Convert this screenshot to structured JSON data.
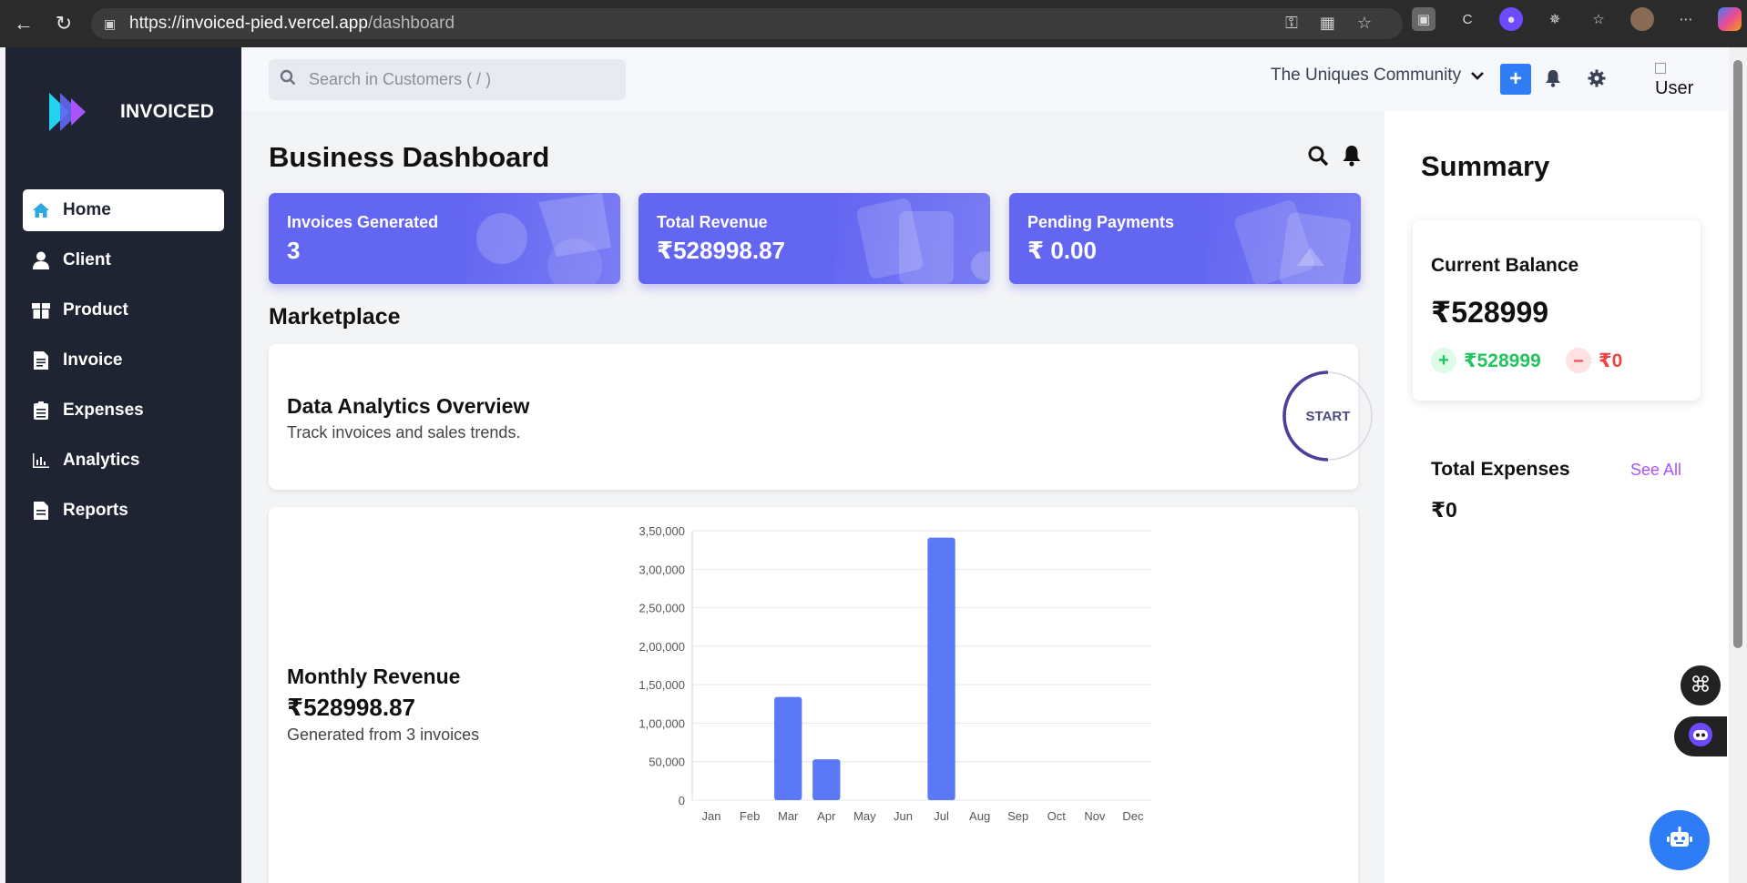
{
  "browser": {
    "url_prefix": "https://",
    "url_host": "invoiced-pied.vercel.app",
    "url_path": "/dashboard"
  },
  "brand": {
    "name": "INVOICED"
  },
  "sidebar": {
    "items": [
      {
        "label": "Home",
        "icon": "home-icon"
      },
      {
        "label": "Client",
        "icon": "user-icon"
      },
      {
        "label": "Product",
        "icon": "box-icon"
      },
      {
        "label": "Invoice",
        "icon": "file-invoice-icon"
      },
      {
        "label": "Expenses",
        "icon": "clipboard-icon"
      },
      {
        "label": "Analytics",
        "icon": "bar-chart-icon"
      },
      {
        "label": "Reports",
        "icon": "document-icon"
      }
    ],
    "active": "Home"
  },
  "header": {
    "search_placeholder": "Search in Customers ( / )",
    "community": "The Uniques Community",
    "add_label": "+",
    "avatar_alt": "User"
  },
  "dashboard": {
    "title": "Business Dashboard",
    "stats": [
      {
        "label": "Invoices Generated",
        "value": "3"
      },
      {
        "label": "Total Revenue",
        "value": "₹528998.87"
      },
      {
        "label": "Pending Payments",
        "value": "₹ 0.00"
      }
    ],
    "marketplace_title": "Marketplace",
    "marketplace_card": {
      "title": "Data Analytics Overview",
      "description": "Track invoices and sales trends.",
      "button": "START"
    },
    "revenue_card": {
      "title": "Monthly Revenue",
      "value": "₹528998.87",
      "subtitle": "Generated from 3 invoices"
    }
  },
  "summary": {
    "title": "Summary",
    "balance_label": "Current Balance",
    "balance_value": "₹528999",
    "income_value": "₹528999",
    "expense_value": "₹0",
    "total_expenses_label": "Total Expenses",
    "see_all": "See All",
    "total_expenses_value": "₹0"
  },
  "colors": {
    "sidebar_bg": "#1f2433",
    "stat_card": "#6366f1",
    "bar": "#5b78f6",
    "primary_button": "#2f7df6",
    "positive": "#22c55e",
    "negative": "#ef4444",
    "link": "#a855f7"
  },
  "chart_data": {
    "type": "bar",
    "categories": [
      "Jan",
      "Feb",
      "Mar",
      "Apr",
      "May",
      "Jun",
      "Jul",
      "Aug",
      "Sep",
      "Oct",
      "Nov",
      "Dec"
    ],
    "values": [
      0,
      0,
      134000,
      53000,
      0,
      0,
      341000,
      0,
      0,
      0,
      0,
      0
    ],
    "ylim": [
      0,
      350000
    ],
    "yticks": [
      0,
      50000,
      100000,
      150000,
      200000,
      250000,
      300000,
      350000
    ],
    "ytick_labels": [
      "0",
      "50,000",
      "1,00,000",
      "1,50,000",
      "2,00,000",
      "2,50,000",
      "3,00,000",
      "3,50,000"
    ],
    "grid": true,
    "title": "",
    "xlabel": "",
    "ylabel": ""
  }
}
